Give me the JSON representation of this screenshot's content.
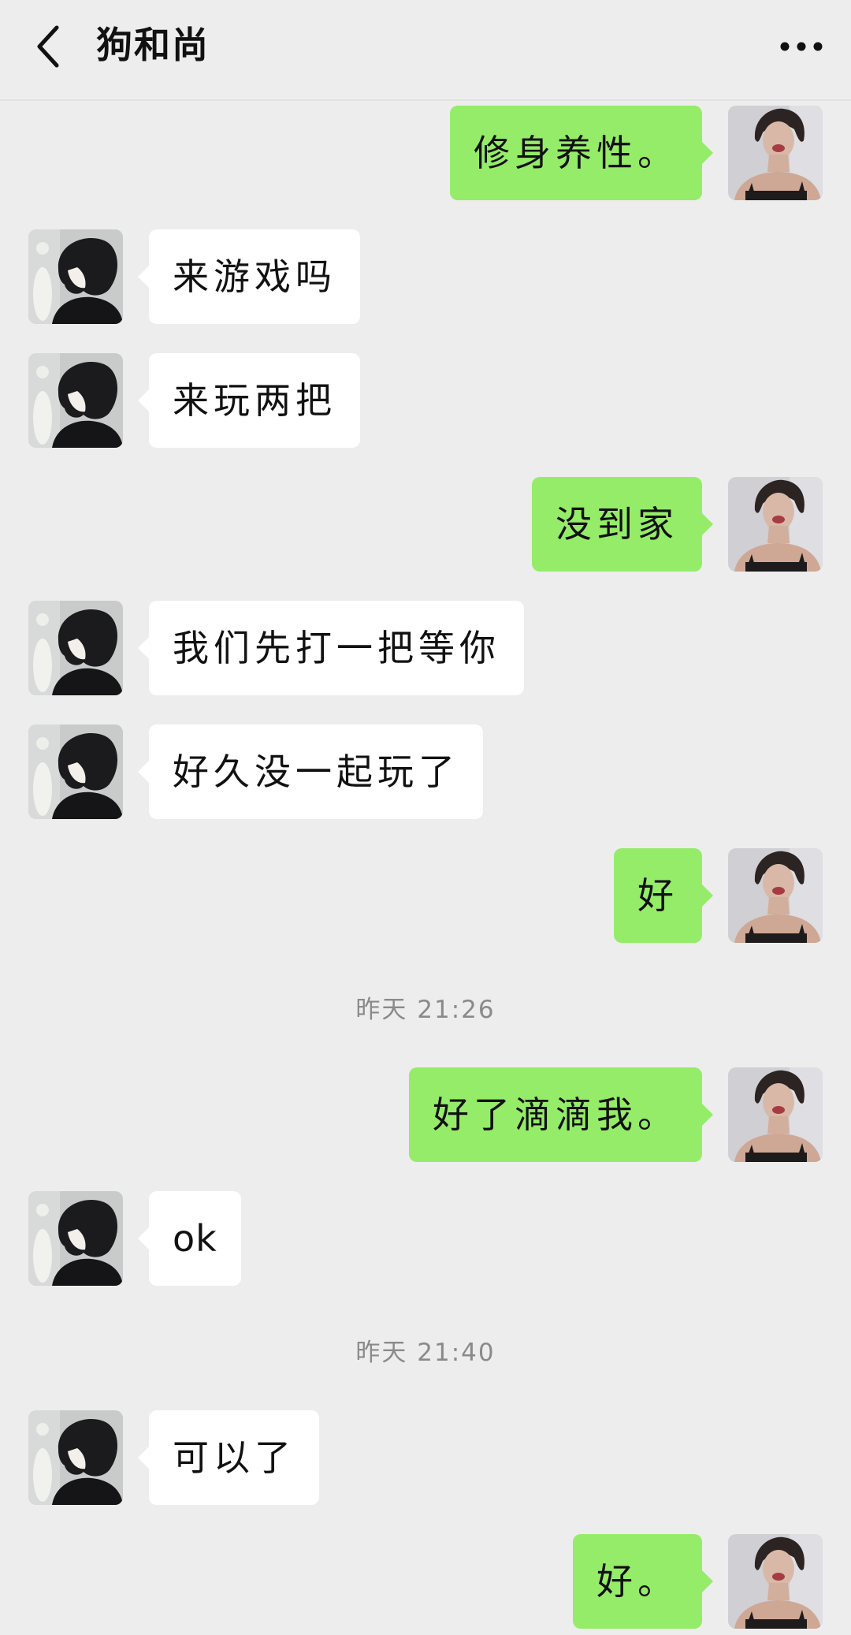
{
  "header": {
    "title": "狗和尚",
    "back_icon": "chevron-left-icon",
    "more_icon": "more-dots-icon"
  },
  "colors": {
    "background": "#ededed",
    "self_bubble": "#95ec69",
    "other_bubble": "#ffffff",
    "timestamp_text": "#8a8a8a"
  },
  "messages": [
    {
      "from": "self",
      "text": "修身养性。"
    },
    {
      "from": "other",
      "text": "来游戏吗"
    },
    {
      "from": "other",
      "text": "来玩两把"
    },
    {
      "from": "self",
      "text": "没到家"
    },
    {
      "from": "other",
      "text": "我们先打一把等你"
    },
    {
      "from": "other",
      "text": "好久没一起玩了"
    },
    {
      "from": "self",
      "text": "好"
    },
    {
      "timestamp": "昨天 21:26"
    },
    {
      "from": "self",
      "text": "好了滴滴我。"
    },
    {
      "from": "other",
      "text": "ok"
    },
    {
      "timestamp": "昨天 21:40"
    },
    {
      "from": "other",
      "text": "可以了"
    },
    {
      "from": "self",
      "text": "好。"
    }
  ]
}
